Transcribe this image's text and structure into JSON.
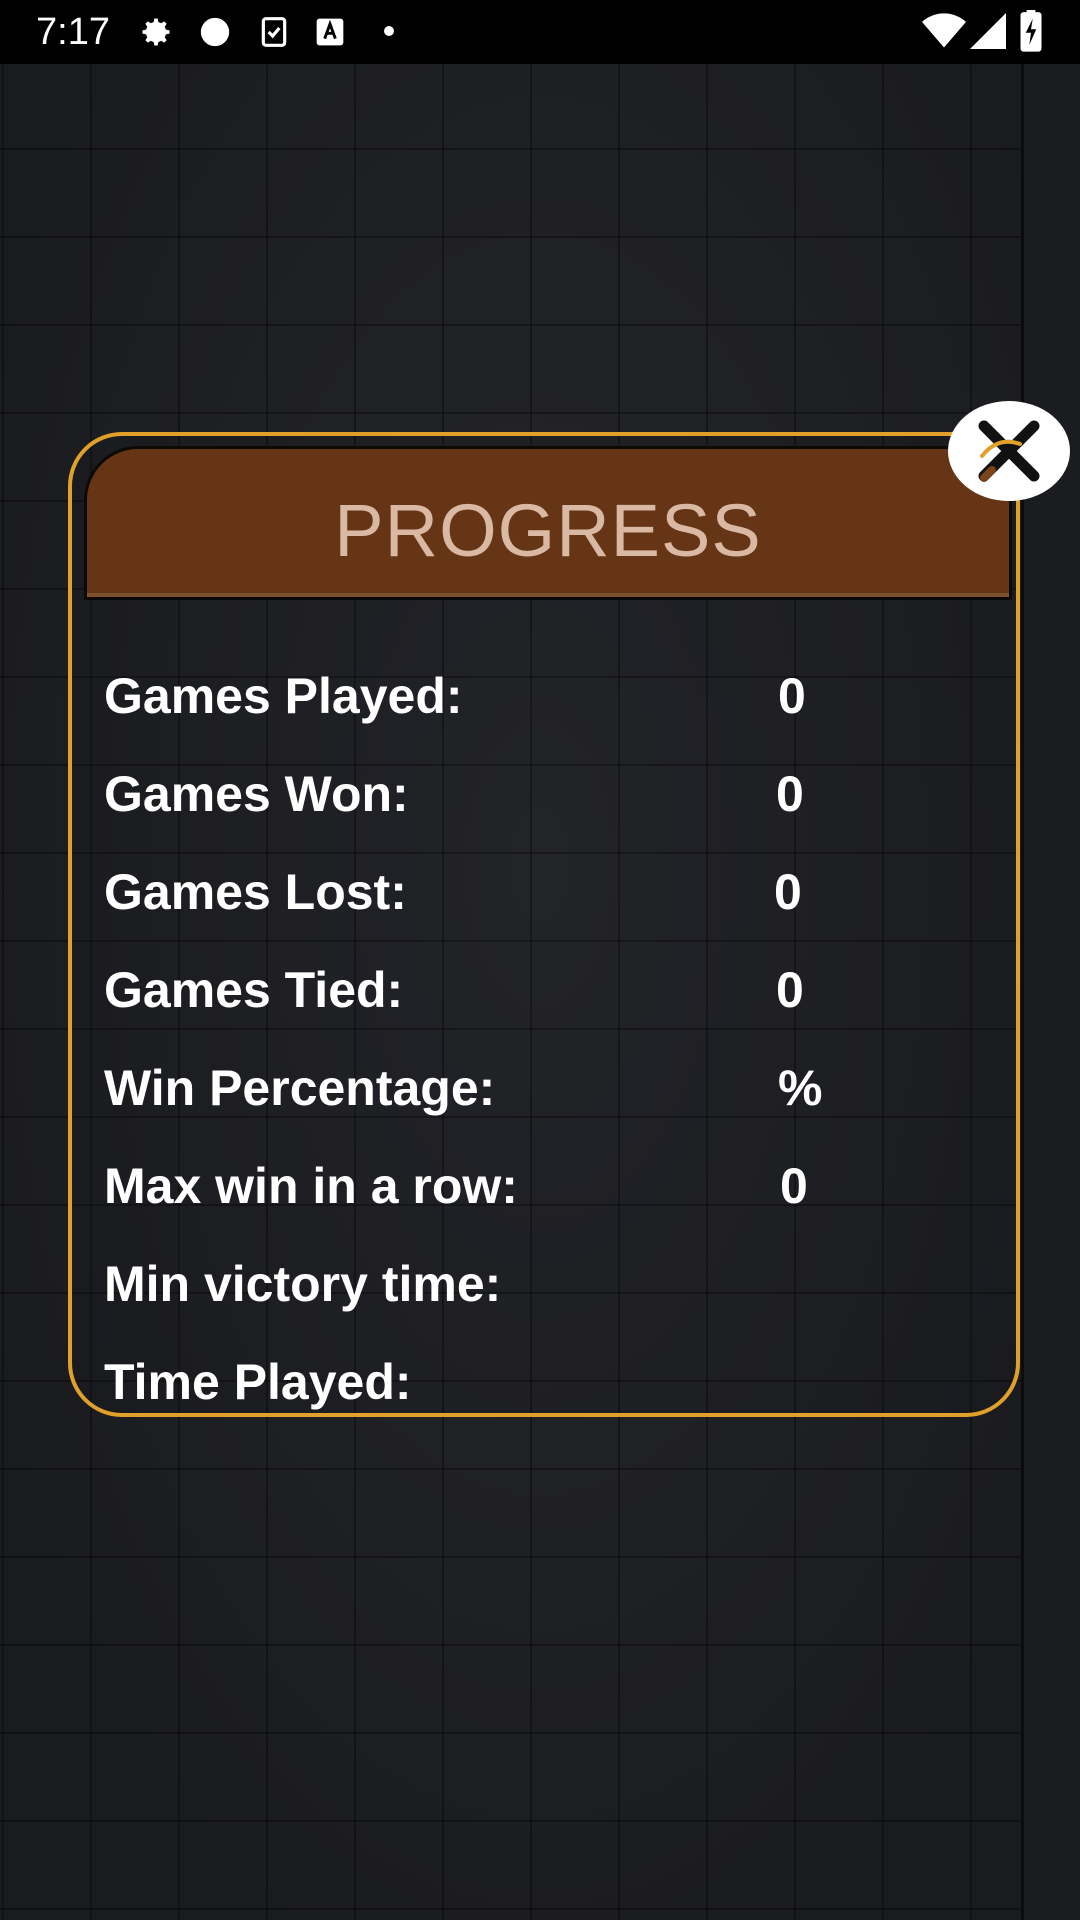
{
  "status_bar": {
    "time": "7:17",
    "icons": [
      "gear-icon",
      "circle-icon",
      "clipboard-check-icon",
      "font-a-icon",
      "dot-icon",
      "wifi-icon",
      "signal-icon",
      "battery-charging-icon"
    ]
  },
  "dialog": {
    "title": "PROGRESS",
    "close_icon": "close-x-icon",
    "stats": [
      {
        "label": "Games Played:",
        "value": "0"
      },
      {
        "label": "Games Won:",
        "value": "0"
      },
      {
        "label": "Games Lost:",
        "value": "0"
      },
      {
        "label": "Games Tied:",
        "value": "0"
      },
      {
        "label": "Win Percentage:",
        "value": "%"
      },
      {
        "label": "Max win in a row:",
        "value": "0"
      },
      {
        "label": "Min victory time:",
        "value": ""
      },
      {
        "label": "Time Played:",
        "value": ""
      }
    ]
  },
  "colors": {
    "accent_gold": "#e0a02a",
    "header_brown": "#663515",
    "title_text": "#d9b8a4",
    "background": "#1e1f22"
  }
}
